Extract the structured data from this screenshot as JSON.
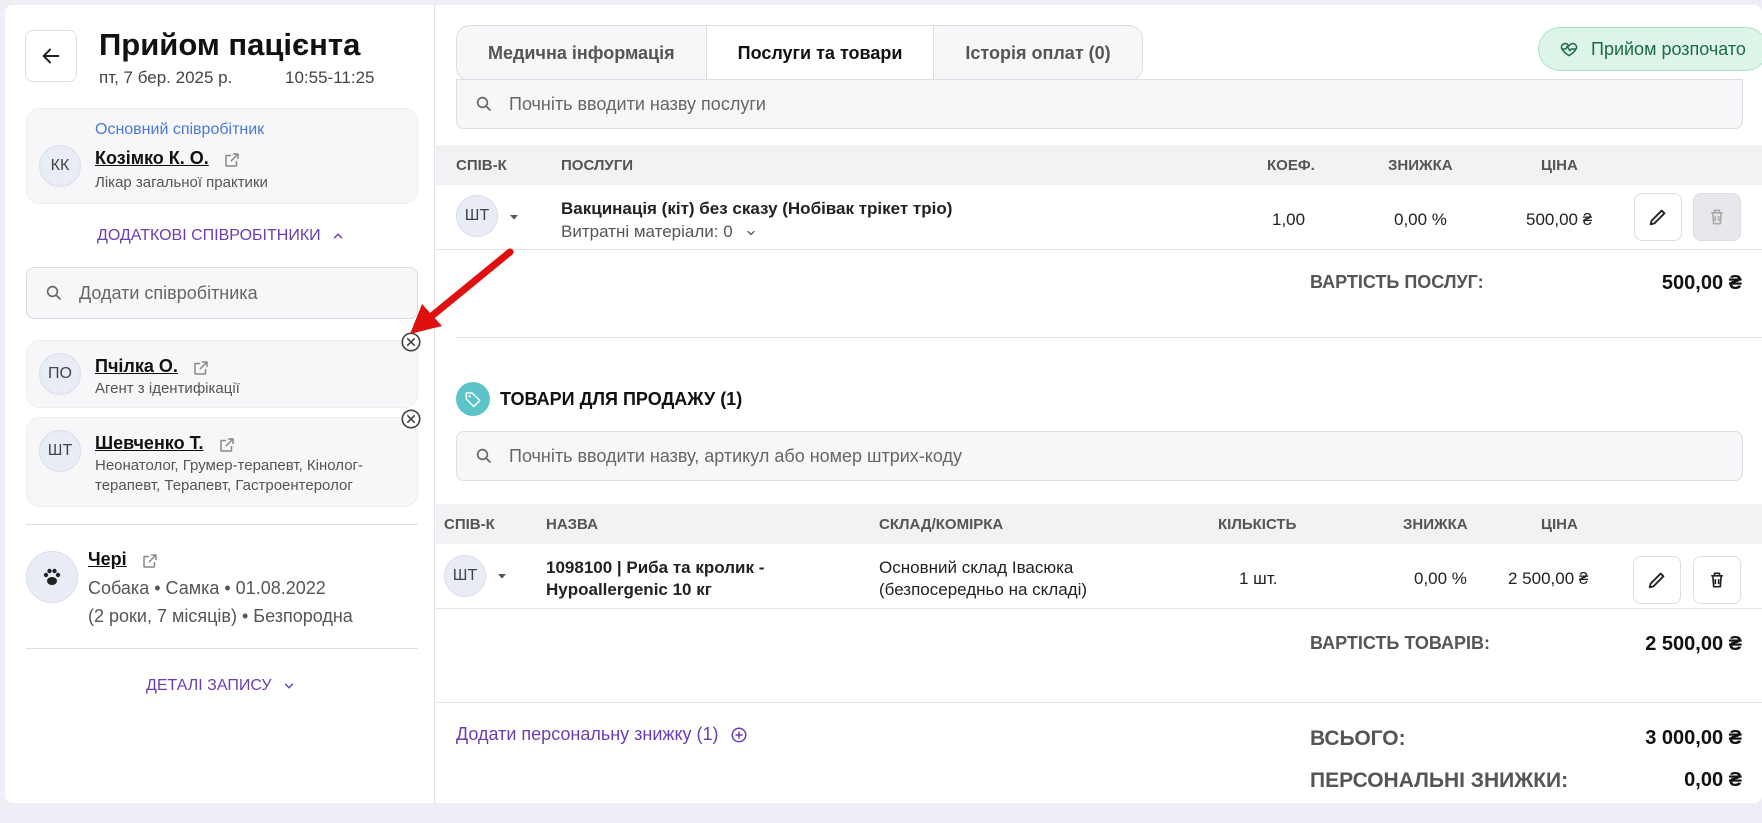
{
  "header": {
    "title": "Прийом пацієнта",
    "date": "пт, 7 бер. 2025 р.",
    "time": "10:55-11:25"
  },
  "main_employee": {
    "section_label": "Основний співробітник",
    "initials": "КК",
    "name": "Козімко К. О.",
    "role": "Лікар загальної практики"
  },
  "additional": {
    "toggle_label": "ДОДАТКОВІ СПІВРОБІТНИКИ",
    "search_placeholder": "Додати співробітника",
    "employees": [
      {
        "initials": "ПО",
        "name": "Пчілка О.",
        "role": "Агент з ідентифікації"
      },
      {
        "initials": "ШТ",
        "name": "Шевченко Т.",
        "role": "Неонатолог, Грумер-терапевт, Кінолог-терапевт, Терапевт, Гастроентеролог"
      }
    ]
  },
  "pet": {
    "name": "Чері",
    "line1": "Собака • Самка • 01.08.2022",
    "line2": "(2 роки, 7 місяців) • Безпородна"
  },
  "details_toggle": "ДЕТАЛІ ЗАПИСУ",
  "tabs": [
    {
      "label": "Медична інформація",
      "active": false
    },
    {
      "label": "Послуги та товари",
      "active": true
    },
    {
      "label": "Історія оплат (0)",
      "active": false
    }
  ],
  "status": {
    "label": "Прийом розпочато",
    "color": "#1d6b44"
  },
  "services": {
    "search_placeholder": "Почніть вводити назву послуги",
    "columns": {
      "employee": "СПІВ-К",
      "name": "ПОСЛУГИ",
      "coef": "КОЕФ.",
      "discount": "ЗНИЖКА",
      "price": "ЦІНА"
    },
    "rows": [
      {
        "employee": "ШТ",
        "name": "Вакцинація (кіт) без сказу (Нобівак трікет тріо)",
        "consumables": "Витратні матеріали: 0",
        "coef": "1,00",
        "discount": "0,00 %",
        "price": "500,00 ₴"
      }
    ],
    "total_label": "ВАРТІСТЬ ПОСЛУГ:",
    "total_value": "500,00 ₴"
  },
  "goods": {
    "section_title": "ТОВАРИ ДЛЯ ПРОДАЖУ (1)",
    "search_placeholder": "Почніть вводити назву, артикул або номер штрих-коду",
    "columns": {
      "employee": "СПІВ-К",
      "name": "НАЗВА",
      "warehouse": "СКЛАД/КОМІРКА",
      "qty": "КІЛЬКІСТЬ",
      "discount": "ЗНИЖКА",
      "price": "ЦІНА"
    },
    "rows": [
      {
        "employee": "ШТ",
        "name_line1": "1098100 | Риба та кролик -",
        "name_line2": "Hypoallergenic 10 кг",
        "warehouse_line1": "Основний склад Івасюка",
        "warehouse_line2": "(безпосередньо на складі)",
        "qty": "1 шт.",
        "discount": "0,00 %",
        "price": "2 500,00 ₴"
      }
    ],
    "total_label": "ВАРТІСТЬ ТОВАРІВ:",
    "total_value": "2 500,00 ₴"
  },
  "summary": {
    "add_discount": "Додати персональну знижку (1)",
    "total_label": "ВСЬОГО:",
    "total_value": "3 000,00 ₴",
    "personal_label": "ПЕРСОНАЛЬНІ ЗНИЖКИ:",
    "personal_value": "0,00 ₴"
  },
  "colors": {
    "accent": "#6b3fb3",
    "tag_icon_bg": "#5cc3c8",
    "annotation_arrow": "#e01010"
  }
}
